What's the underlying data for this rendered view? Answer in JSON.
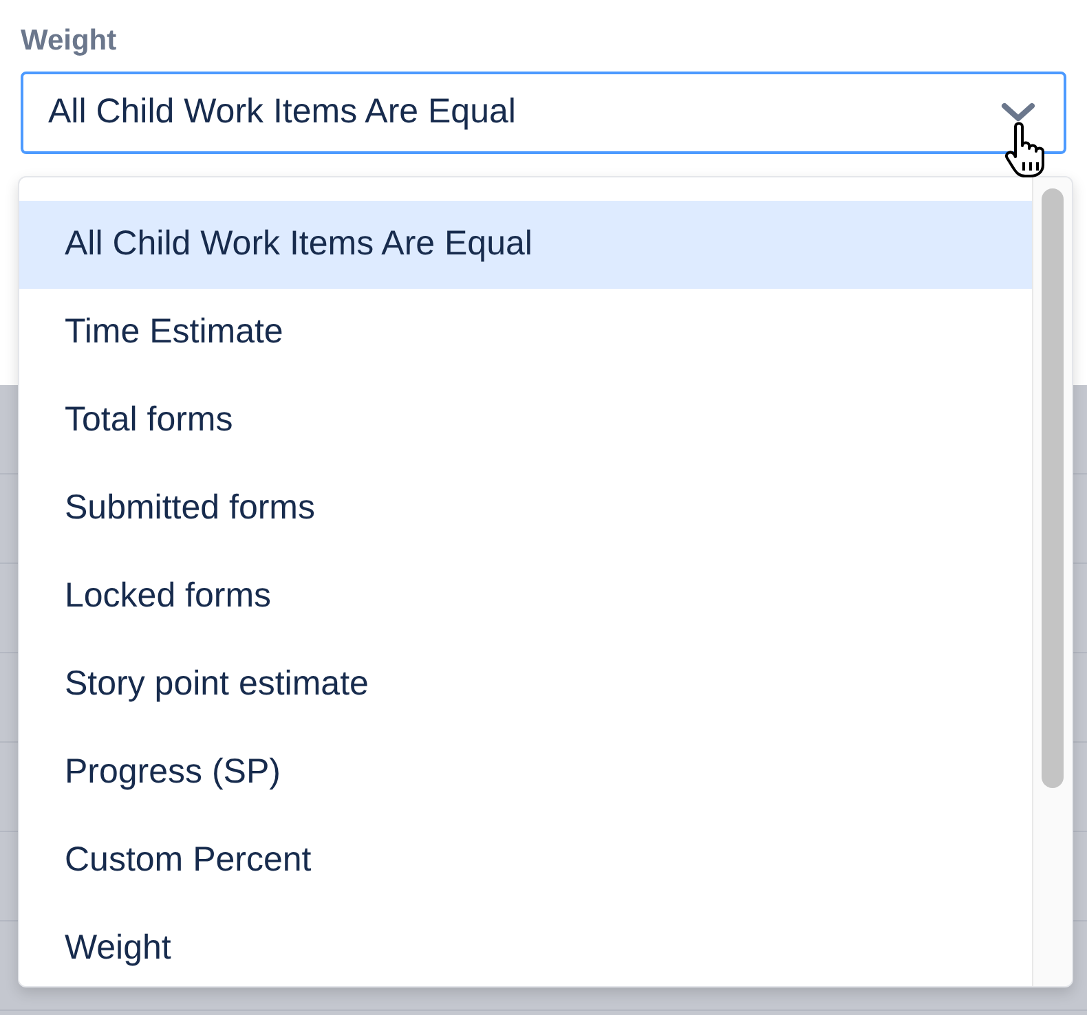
{
  "field": {
    "label": "Weight",
    "value": "All Child Work Items Are Equal",
    "expanded": true
  },
  "options": [
    {
      "label": "All Child Work Items Are Equal",
      "selected": true
    },
    {
      "label": "Time Estimate",
      "selected": false
    },
    {
      "label": "Total forms",
      "selected": false
    },
    {
      "label": "Submitted forms",
      "selected": false
    },
    {
      "label": "Locked forms",
      "selected": false
    },
    {
      "label": "Story point estimate",
      "selected": false
    },
    {
      "label": "Progress (SP)",
      "selected": false
    },
    {
      "label": "Custom Percent",
      "selected": false
    },
    {
      "label": "Weight",
      "selected": false
    }
  ]
}
